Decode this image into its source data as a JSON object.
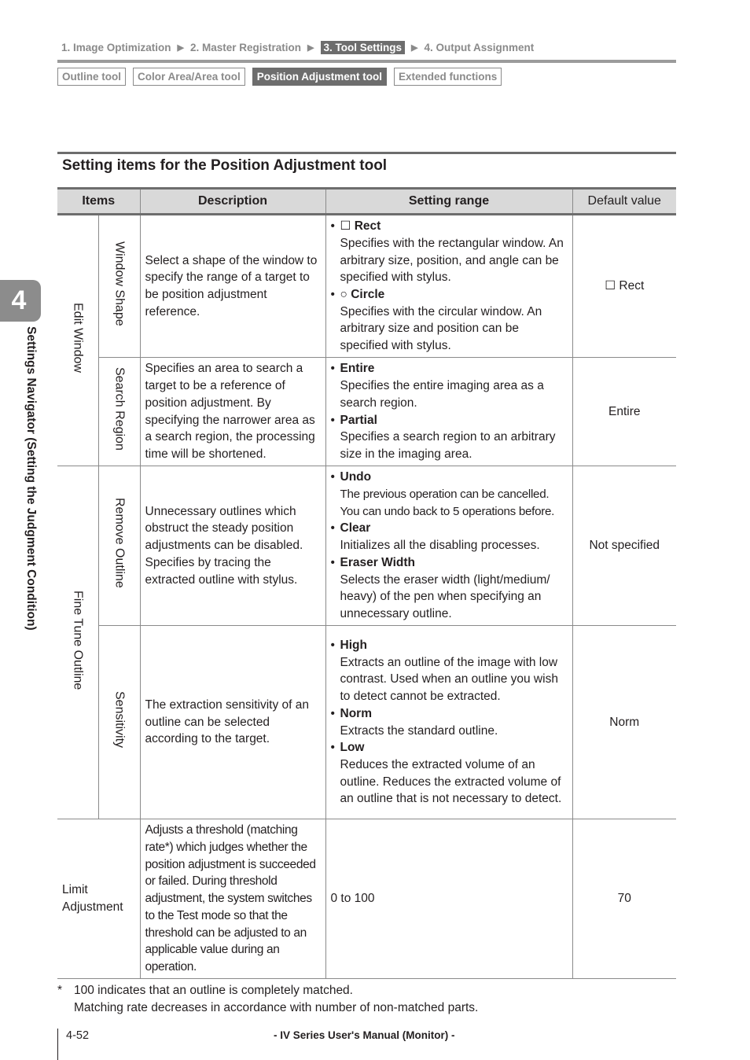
{
  "breadcrumb": {
    "steps": [
      {
        "label": "1. Image Optimization",
        "active": false
      },
      {
        "label": "2. Master Registration",
        "active": false
      },
      {
        "label": "3. Tool Settings",
        "active": true
      },
      {
        "label": "4. Output Assignment",
        "active": false
      }
    ],
    "separator_icon": "right-triangle-arrow"
  },
  "subtabs": [
    {
      "label": "Outline tool",
      "active": false
    },
    {
      "label": "Color Area/Area tool",
      "active": false
    },
    {
      "label": "Position Adjustment tool",
      "active": true
    },
    {
      "label": "Extended functions",
      "active": false
    }
  ],
  "chapter": {
    "number": "4",
    "title": "Settings Navigator (Setting the Judgment Condition)"
  },
  "section": {
    "title": "Setting items for the Position Adjustment tool"
  },
  "table": {
    "headers": [
      "Items",
      "Description",
      "Setting range",
      "Default value"
    ],
    "groups": [
      {
        "label": "Edit Window",
        "rows": [
          {
            "item": "Window Shape",
            "description": "Select a shape of the window to specify the range of a target to be position adjustment reference.",
            "options": [
              {
                "icon": "☐",
                "name": "Rect",
                "desc": "Specifies with the rectangular window. An arbitrary size, position, and angle can be specified with stylus."
              },
              {
                "icon": "○",
                "name": "Circle",
                "desc": "Specifies with the circular window. An arbitrary size and position can be specified with stylus."
              }
            ],
            "default": "☐ Rect"
          },
          {
            "item": "Search Region",
            "description": "Specifies an area to search a target to be a reference of position adjustment. By specifying the narrower area as a search region, the processing time will be shortened.",
            "options": [
              {
                "icon": "",
                "name": "Entire",
                "desc": "Specifies the entire imaging area as a search region."
              },
              {
                "icon": "",
                "name": "Partial",
                "desc": "Specifies a search region to an arbitrary size in the imaging area."
              }
            ],
            "default": "Entire"
          }
        ]
      },
      {
        "label": "Fine Tune Outline",
        "rows": [
          {
            "item": "Remove Outline",
            "description": "Unnecessary outlines which obstruct the steady position adjustments can be disabled. Specifies by tracing the extracted outline with stylus.",
            "options": [
              {
                "icon": "",
                "name": "Undo",
                "desc": "The previous operation can be cancelled. You can undo back to 5 operations before."
              },
              {
                "icon": "",
                "name": "Clear",
                "desc": "Initializes all the disabling processes."
              },
              {
                "icon": "",
                "name": "Eraser Width",
                "desc": "Selects the eraser width (light/medium/ heavy) of the pen when specifying an unnecessary outline."
              }
            ],
            "default": "Not specified"
          },
          {
            "item": "Sensitivity",
            "description": "The extraction sensitivity of an outline can be selected according to the target.",
            "options": [
              {
                "icon": "",
                "name": "High",
                "desc": "Extracts an outline of the image with low contrast. Used when an outline you wish to detect cannot be extracted."
              },
              {
                "icon": "",
                "name": "Norm",
                "desc": "Extracts the standard outline."
              },
              {
                "icon": "",
                "name": "Low",
                "desc": "Reduces the extracted volume of an outline. Reduces the extracted volume of an outline that is not necessary to detect."
              }
            ],
            "default": "Norm"
          }
        ]
      }
    ],
    "limit_row": {
      "item": "Limit Adjustment",
      "description": "Adjusts a threshold (matching rate*) which judges whether the position adjustment is succeeded or failed. During threshold adjustment, the system switches to the Test mode so that the threshold can be adjusted to an applicable value during an operation.",
      "range": "0 to 100",
      "default": "70"
    }
  },
  "footnote": {
    "marker": "*",
    "lines": [
      "100 indicates that an outline is completely matched.",
      "Matching rate decreases in accordance with number of non-matched parts."
    ]
  },
  "footer": {
    "page": "4-52",
    "manual": "- IV Series User's Manual (Monitor) -"
  }
}
